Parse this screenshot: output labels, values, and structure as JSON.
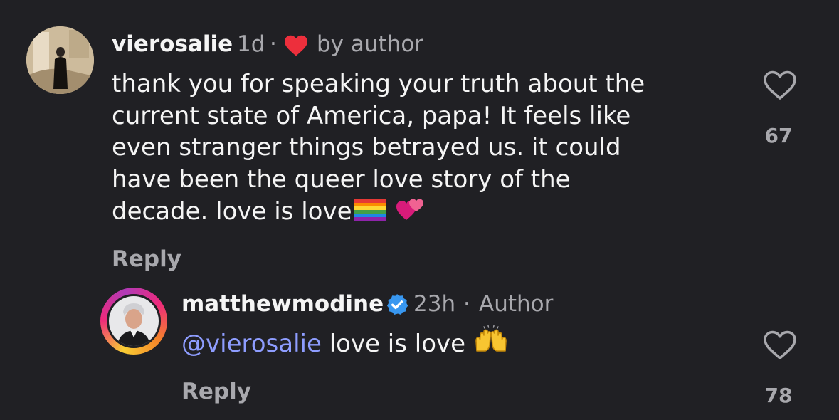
{
  "comment": {
    "username": "vierosalie",
    "time": "1d",
    "dot": "·",
    "liked_by": "by author",
    "lines": [
      "thank you for speaking your truth about the",
      "current state of America, papa! It feels like",
      "even stranger things betrayed us. it could",
      "have been the queer love story of the",
      "decade. love is love"
    ],
    "emoji": [
      "rainbow-flag",
      "two-hearts"
    ],
    "reply_label": "Reply",
    "like_count": "67"
  },
  "reply": {
    "username": "matthewmodine",
    "verified": true,
    "time": "23h",
    "dot": "·",
    "badge": "Author",
    "mention": "@vierosalie",
    "text": " love is love",
    "emoji": [
      "raising-hands"
    ],
    "reply_label": "Reply",
    "like_count": "78"
  },
  "colors": {
    "background": "#202024",
    "primary_text": "#f5f5f5",
    "secondary_text": "#a8a8ad",
    "mention": "#8e9dff",
    "verified": "#3897f0",
    "author_heart": "#ed2f3c"
  }
}
